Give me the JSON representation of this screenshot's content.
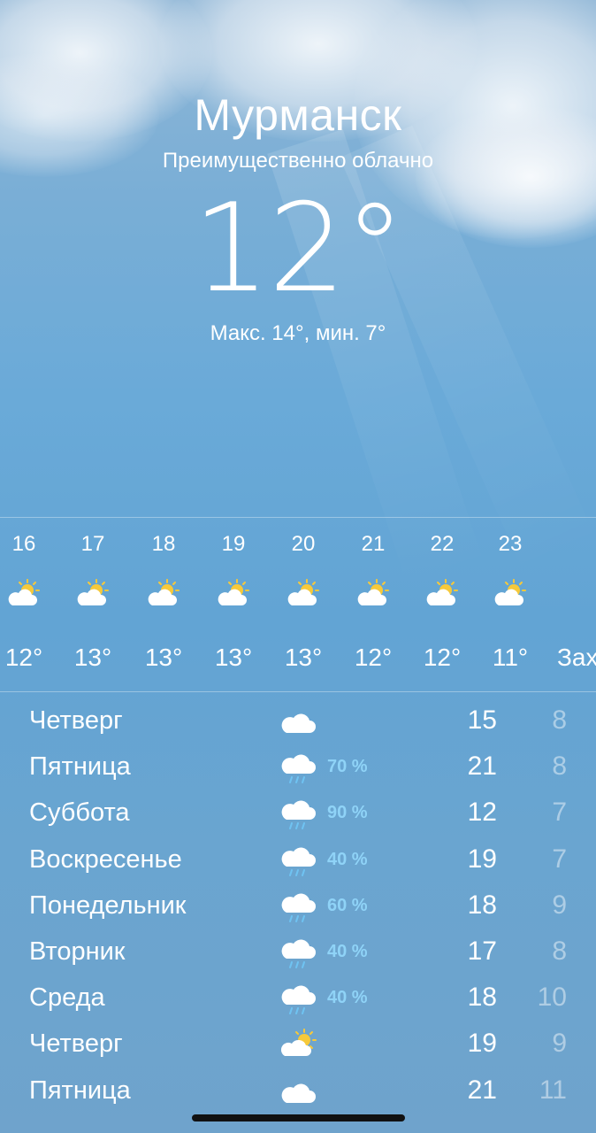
{
  "header": {
    "city": "Мурманск",
    "condition": "Преимущественно облачно",
    "temperature": "12°",
    "hilo": "Макс. 14°, мин. 7°"
  },
  "hourly": [
    {
      "label": "16",
      "icon": "partly-cloudy-icon",
      "temp": "12°"
    },
    {
      "label": "17",
      "icon": "partly-cloudy-icon",
      "temp": "13°"
    },
    {
      "label": "18",
      "icon": "partly-cloudy-icon",
      "temp": "13°"
    },
    {
      "label": "19",
      "icon": "partly-cloudy-icon",
      "temp": "13°"
    },
    {
      "label": "20",
      "icon": "partly-cloudy-icon",
      "temp": "13°"
    },
    {
      "label": "21",
      "icon": "partly-cloudy-icon",
      "temp": "12°"
    },
    {
      "label": "22",
      "icon": "partly-cloudy-icon",
      "temp": "12°"
    },
    {
      "label": "23",
      "icon": "partly-cloudy-icon",
      "temp": "11°"
    },
    {
      "label": "",
      "icon": "",
      "temp": "Заход"
    }
  ],
  "daily": [
    {
      "day": "Четверг",
      "icon": "cloud-icon",
      "precip": "",
      "hi": "15",
      "lo": "8"
    },
    {
      "day": "Пятница",
      "icon": "rain-cloud-icon",
      "precip": "70 %",
      "hi": "21",
      "lo": "8"
    },
    {
      "day": "Суббота",
      "icon": "rain-cloud-icon",
      "precip": "90 %",
      "hi": "12",
      "lo": "7"
    },
    {
      "day": "Воскресенье",
      "icon": "rain-cloud-icon",
      "precip": "40 %",
      "hi": "19",
      "lo": "7"
    },
    {
      "day": "Понедельник",
      "icon": "rain-cloud-icon",
      "precip": "60 %",
      "hi": "18",
      "lo": "9"
    },
    {
      "day": "Вторник",
      "icon": "rain-cloud-icon",
      "precip": "40 %",
      "hi": "17",
      "lo": "8"
    },
    {
      "day": "Среда",
      "icon": "rain-cloud-icon",
      "precip": "40 %",
      "hi": "18",
      "lo": "10"
    },
    {
      "day": "Четверг",
      "icon": "partly-cloudy-icon",
      "precip": "",
      "hi": "19",
      "lo": "9"
    },
    {
      "day": "Пятница",
      "icon": "cloud-icon",
      "precip": "",
      "hi": "21",
      "lo": "11"
    }
  ],
  "colors": {
    "precip": "#8fd3f7",
    "sun": "#f6c93a",
    "rain": "#6fc3f2"
  }
}
